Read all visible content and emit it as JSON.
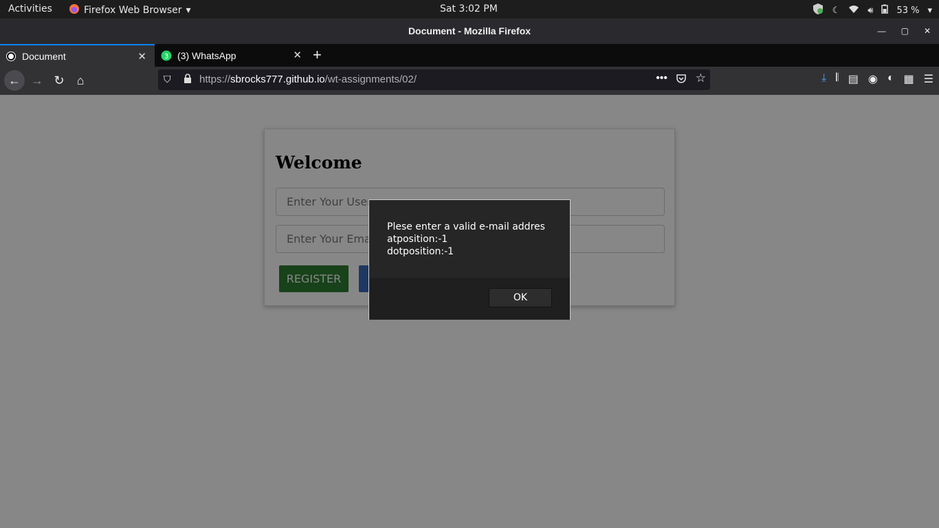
{
  "topbar": {
    "activities": "Activities",
    "app_name": "Firefox Web Browser",
    "clock": "Sat  3:02 PM",
    "battery": "53 %"
  },
  "window": {
    "title": "Document - Mozilla Firefox"
  },
  "tabs": [
    {
      "label": "Document",
      "active": true
    },
    {
      "label": "(3) WhatsApp",
      "active": false,
      "badge": "3"
    }
  ],
  "urlbar": {
    "scheme": "https://",
    "host": "sbrocks777.github.io",
    "path": "/wt-assignments/02/"
  },
  "page": {
    "heading": "Welcome",
    "username_placeholder": "Enter Your Username",
    "email_placeholder": "Enter Your Email",
    "register_label": "REGISTER"
  },
  "dialog": {
    "line1": "Plese enter a valid e-mail addres",
    "line2": "atposition:-1",
    "line3": "dotposition:-1",
    "ok_label": "OK"
  },
  "colors": {
    "tab_accent": "#0a84ff",
    "register_button": "#2e7d32",
    "second_button": "#3a6bb7"
  }
}
